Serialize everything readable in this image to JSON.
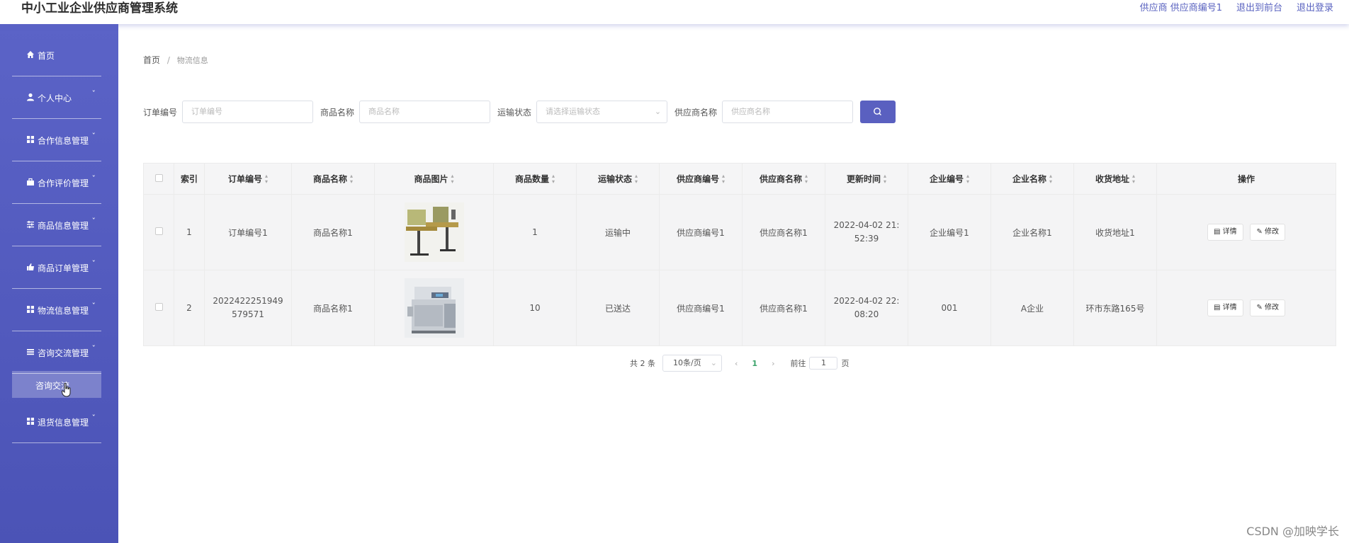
{
  "app": {
    "title": "中小工业企业供应商管理系统",
    "user_label": "供应商 供应商编号1",
    "to_front": "退出到前台",
    "logout": "退出登录"
  },
  "sidebar": {
    "items": [
      {
        "label": "首页",
        "icon": "home-icon",
        "has_arrow": false
      },
      {
        "label": "个人中心",
        "icon": "user-icon",
        "has_arrow": true
      },
      {
        "label": "合作信息管理",
        "icon": "grid-icon",
        "has_arrow": true
      },
      {
        "label": "合作评价管理",
        "icon": "briefcase-icon",
        "has_arrow": true
      },
      {
        "label": "商品信息管理",
        "icon": "sliders-icon",
        "has_arrow": true
      },
      {
        "label": "商品订单管理",
        "icon": "thumb-icon",
        "has_arrow": true
      },
      {
        "label": "物流信息管理",
        "icon": "grid-icon",
        "has_arrow": true
      },
      {
        "label": "咨询交流管理",
        "icon": "list-icon",
        "has_arrow": true
      },
      {
        "label": "退货信息管理",
        "icon": "grid-icon",
        "has_arrow": true
      }
    ],
    "active_sub": "咨询交流",
    "arrow": "ˇ"
  },
  "breadcrumb": {
    "home": "首页",
    "sep": "/",
    "current": "物流信息"
  },
  "search": {
    "order_label": "订单编号",
    "order_placeholder": "订单编号",
    "product_label": "商品名称",
    "product_placeholder": "商品名称",
    "status_label": "运输状态",
    "status_placeholder": "请选择运输状态",
    "supplier_label": "供应商名称",
    "supplier_placeholder": "供应商名称"
  },
  "table": {
    "headers": [
      "索引",
      "订单编号",
      "商品名称",
      "商品图片",
      "商品数量",
      "运输状态",
      "供应商编号",
      "供应商名称",
      "更新时间",
      "企业编号",
      "企业名称",
      "收货地址",
      "操作"
    ],
    "rows": [
      {
        "index": "1",
        "order": "订单编号1",
        "product": "商品名称1",
        "image": "desk-photo",
        "qty": "1",
        "status": "运输中",
        "supplier_no": "供应商编号1",
        "supplier_name": "供应商名称1",
        "updated": "2022-04-02 21:52:39",
        "ent_no": "企业编号1",
        "ent_name": "企业名称1",
        "address": "收货地址1"
      },
      {
        "index": "2",
        "order": "2022422251949579571",
        "product": "商品名称1",
        "image": "copier-photo",
        "qty": "10",
        "status": "已送达",
        "supplier_no": "供应商编号1",
        "supplier_name": "供应商名称1",
        "updated": "2022-04-02 22:08:20",
        "ent_no": "001",
        "ent_name": "A企业",
        "address": "环市东路165号"
      }
    ],
    "detail_btn": "详情",
    "edit_btn": "修改"
  },
  "pager": {
    "total": "共 2 条",
    "page_size": "10条/页",
    "current_page": "1",
    "goto_label": "前往",
    "goto_value": "1",
    "page_suffix": "页"
  },
  "watermark": "CSDN @加映学长",
  "colors": {
    "accent": "#5a60c0",
    "sidebar": "#5059c0",
    "active_page": "#3aa36a"
  }
}
